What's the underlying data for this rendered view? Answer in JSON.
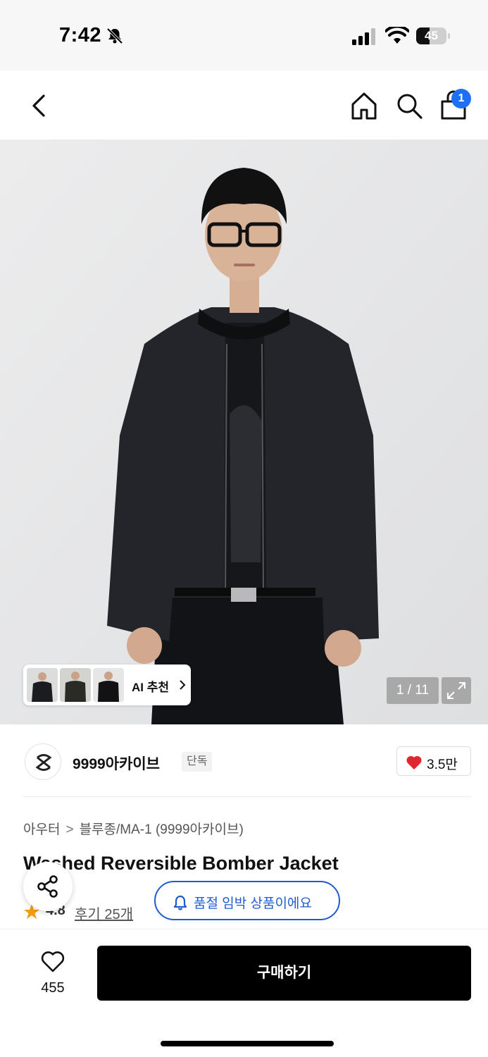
{
  "status_bar": {
    "time": "7:42",
    "battery": "45",
    "battery_level": 0.45
  },
  "nav": {
    "cart_badge": "1"
  },
  "gallery": {
    "ai_label": "AI 추천",
    "page_indicator": "1 / 11"
  },
  "brand": {
    "name": "9999아카이브",
    "tag": "단독",
    "like_count": "3.5만"
  },
  "product": {
    "breadcrumb": {
      "category": "아우터",
      "separator": ">",
      "subcategory": "블루종/MA-1 (9999아카이브)"
    },
    "title": "Washed Reversible Bomber Jacket",
    "rating": "4.8",
    "reviews": "후기 25개",
    "stock_notice": "품절 임박 상품이에요"
  },
  "bottom_bar": {
    "wish_count": "455",
    "buy_label": "구매하기"
  },
  "colors": {
    "accent_blue": "#1f5cd0",
    "badge_blue": "#1f6ff2",
    "heart_red": "#e0262f",
    "star_orange": "#f39c12",
    "buy_button": "#000000"
  }
}
